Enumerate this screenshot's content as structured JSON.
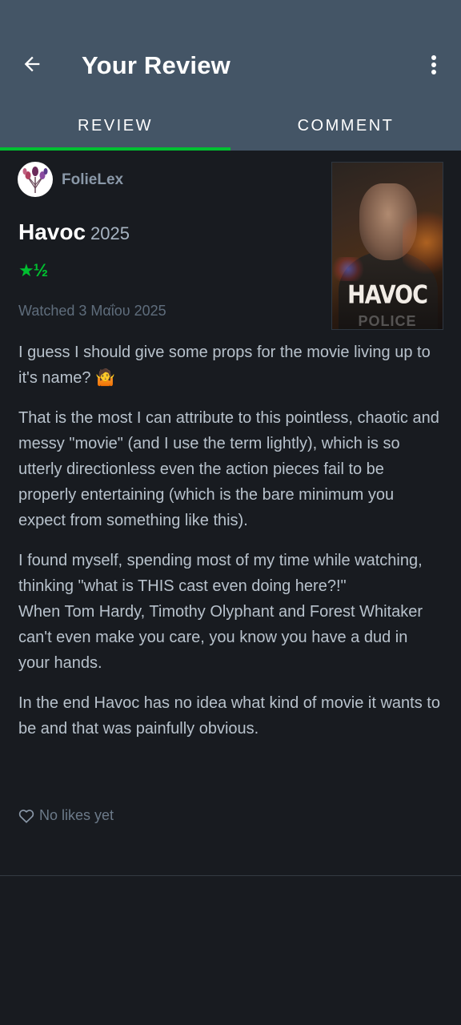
{
  "header": {
    "title": "Your Review",
    "back_icon": "arrow-left-icon",
    "more_icon": "more-vertical-icon",
    "tabs": [
      {
        "label": "REVIEW",
        "active": true
      },
      {
        "label": "COMMENT",
        "active": false
      }
    ]
  },
  "review": {
    "username": "FolieLex",
    "film_title": "Havoc",
    "film_year": "2025",
    "rating_display": "★½",
    "rating_value": 1.5,
    "watched": "Watched 3 Μαΐου 2025",
    "poster": {
      "title_text": "HAVOC",
      "footer_text": "POLICE"
    },
    "paragraphs": [
      "I guess I should give some props for the movie living up to it's name? 🤷",
      "That is the most I can attribute to this pointless, chaotic and messy \"movie\" (and I use the term lightly), which is so utterly directionless even the action pieces fail to be properly entertaining (which is the bare minimum you expect from something like this).",
      "I found myself, spending most of my time while watching, thinking \"what is THIS cast even doing here?!\"\nWhen Tom Hardy, Timothy Olyphant and Forest Whitaker can't even make you care, you know you have a dud in your hands.",
      "In the end Havoc has no idea what kind of movie it wants to be and that was painfully obvious."
    ],
    "likes_text": "No likes yet"
  },
  "colors": {
    "header_bg": "#445566",
    "page_bg": "#181b20",
    "accent_green": "#00c030"
  }
}
